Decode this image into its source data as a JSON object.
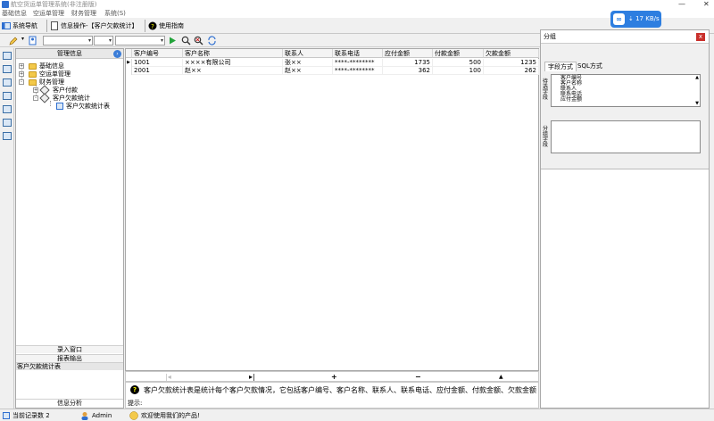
{
  "window": {
    "title": "航空货运单管理系统(非注册版)",
    "minimize": "—",
    "close": "✕"
  },
  "menu": [
    "基础信息",
    "空运单管理",
    "财务管理",
    "系统(S)"
  ],
  "tabs": [
    {
      "label": "系统导航",
      "icon": "nav-icon"
    },
    {
      "label": "信息操作-【客户欠款统计】",
      "icon": "document-icon"
    },
    {
      "label": "使用指南",
      "icon": "help-icon"
    }
  ],
  "toolbar": {
    "combo1_value": "",
    "combo2_value": "",
    "run_icon": "play-icon",
    "search_icon": "search-icon",
    "search_clear_icon": "search-clear-icon",
    "refresh_icon": "refresh-icon"
  },
  "left_panel": {
    "header": "管理信息",
    "tree": [
      {
        "label": "基础信息",
        "level": 0,
        "expander": "+"
      },
      {
        "label": "空运单管理",
        "level": 0,
        "expander": "+"
      },
      {
        "label": "财务管理",
        "level": 0,
        "expander": "-"
      },
      {
        "label": "客户付款",
        "level": 1,
        "expander": "+"
      },
      {
        "label": "客户欠款统计",
        "level": 1,
        "expander": "-"
      },
      {
        "label": "客户欠款统计表",
        "level": 2,
        "expander": ""
      }
    ],
    "bottom": {
      "import_window": "录入窗口",
      "report_output": "报表输出",
      "report_item": "客户欠款统计表",
      "info_analysis": "信息分析"
    }
  },
  "grid": {
    "columns": [
      "客户编号",
      "客户名称",
      "联系人",
      "联系电话",
      "应付金额",
      "付款金额",
      "欠款金额"
    ],
    "rows": [
      [
        "1001",
        "××××有限公司",
        "张××",
        "****-********",
        "1735",
        "500",
        "1235"
      ],
      [
        "2001",
        "赵××",
        "赵××",
        "****-********",
        "362",
        "100",
        "262"
      ]
    ]
  },
  "navigator": {
    "first": "|◂",
    "last": "▸|",
    "add": "+",
    "delete": "−",
    "up": "▲"
  },
  "description": {
    "text": "客户欠款统计表是统计每个客户欠款情况，它包括客户编号、客户名称、联系人、联系电话、应付金额、付款金额、欠款金额",
    "tip_label": "提示:"
  },
  "right_panel": {
    "title": "分组",
    "close": "x",
    "tabs": [
      "字段方式",
      "SQL方式"
    ],
    "field_label": "待选字段",
    "fields": [
      "客户编号",
      "客户名称",
      "联系人",
      "联系电话",
      "应付金额"
    ],
    "group_label": "分组字段"
  },
  "status": {
    "record_count": "当前记录数 2",
    "user": "Admin",
    "welcome": "欢迎使用我们的产品!"
  },
  "net_widget": {
    "speed": "⇣ 17 KB/s"
  },
  "colors": {
    "accent": "#2d7ee0",
    "folder": "#f3c94a",
    "close": "#c9302c"
  }
}
